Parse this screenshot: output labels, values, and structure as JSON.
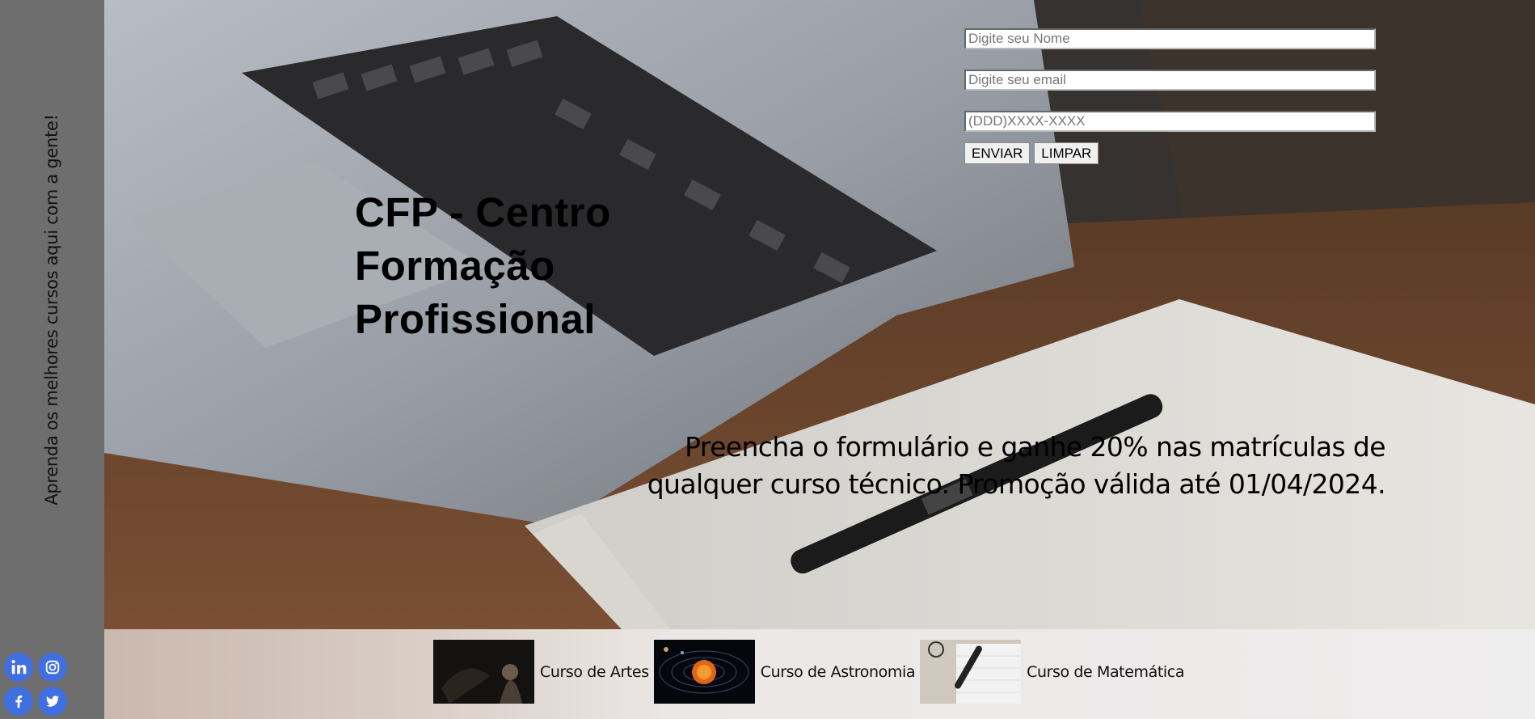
{
  "sidebar": {
    "tagline": "Aprenda os melhores cursos aqui com a gente!",
    "social_icons": [
      "linkedin-icon",
      "instagram-icon",
      "facebook-icon",
      "twitter-icon"
    ],
    "accent": "#3f6fe0"
  },
  "hero": {
    "title_lines": [
      "CFP - Centro",
      "Formação",
      "Profissional"
    ],
    "promo": "Preencha o formulário e ganhe 20% nas matrículas de qualquer curso técnico. Promoção válida até 01/04/2024."
  },
  "form": {
    "name_placeholder": "Digite seu Nome",
    "email_placeholder": "Digite seu email",
    "phone_placeholder": "(DDD)XXXX-XXXX",
    "submit_label": "ENVIAR",
    "reset_label": "LIMPAR"
  },
  "courses": [
    {
      "label": "Curso de Artes"
    },
    {
      "label": "Curso de Astronomia"
    },
    {
      "label": "Curso de Matemática"
    }
  ]
}
